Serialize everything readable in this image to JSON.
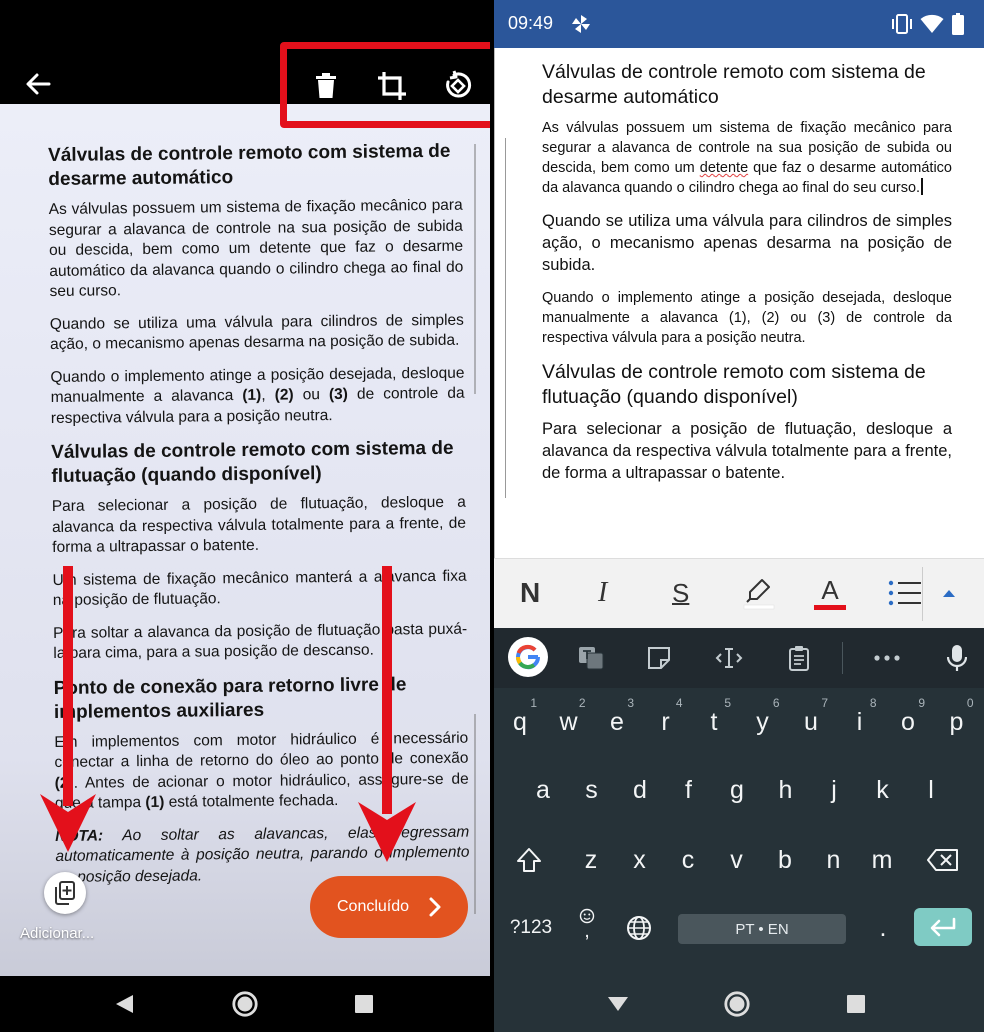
{
  "left_pane": {
    "toolbar": {
      "back_icon": "arrow-left-icon",
      "delete_icon": "trash-icon",
      "crop_icon": "crop-icon",
      "rotate_icon": "rotate-icon",
      "highlight_color": "#e3101b"
    },
    "scanned_document": {
      "heading_1": "Válvulas de controle remoto com sistema de desarme automático",
      "para_1": "As válvulas possuem um sistema de fixação mecânico para segurar a alavanca de controle na sua posição de subida ou descida, bem como um detente que faz o desarme automático da alavanca quando o cilindro chega ao final do seu curso.",
      "para_2": "Quando se utiliza uma válvula para cilindros de simples ação, o mecanismo apenas desarma na posição de subida.",
      "para_3_a": "Quando o implemento atinge a posição desejada, desloque manualmente a alavanca ",
      "para_3_b1": "(1)",
      "para_3_c": ", ",
      "para_3_b2": "(2)",
      "para_3_d": " ou ",
      "para_3_b3": "(3)",
      "para_3_e": " de controle da respectiva válvula para a posição neutra.",
      "heading_2": "Válvulas de controle remoto com sistema de flutuação (quando disponível)",
      "para_4": "Para selecionar a posição de flutuação, desloque a alavanca da respectiva válvula totalmente para a frente, de forma a ultrapassar o batente.",
      "para_5": "Um sistema de fixação mecânico manterá a alavanca fixa na posição de flutuação.",
      "para_6": "Para soltar a alavanca da posição de flutuação basta puxá-la para cima, para a sua posição de descanso.",
      "heading_3": "Ponto de conexão para retorno livre de implementos auxiliares",
      "para_7_a": "Em implementos com motor hidráulico é necessário conectar a linha de retorno do óleo ao ponto de conexão ",
      "para_7_b": "(2)",
      "para_7_c": ". Antes de acionar o motor hidráulico, assegure-se de que a tampa ",
      "para_7_d": "(1)",
      "para_7_e": " está totalmente fechada.",
      "nota_label": "NOTA:",
      "nota_text": " Ao soltar as alavancas, elas regressam automaticamente à posição neutra, parando o implemento na posição desejada."
    },
    "add_button_icon": "add-page-icon",
    "add_label": "Adicionar...",
    "done_button_label": "Concluído",
    "done_button_color": "#e2531f",
    "arrow_color": "#e3101b"
  },
  "right_pane": {
    "status_bar": {
      "time": "09:49",
      "bg_color": "#2b569a"
    },
    "document": {
      "heading_1": "Válvulas de controle remoto com sistema de desarme automático",
      "para_1_a": "As válvulas possuem um sistema de fixação mecânico para segurar a alavanca de controle na sua posição de subida ou descida, bem como um ",
      "para_1_spell": "detente",
      "para_1_b": " que faz o desarme automático da alavanca quando o cilindro chega ao final do seu curso.",
      "para_2": "Quando se utiliza uma válvula para cilindros de simples ação, o mecanismo apenas desarma na posição de subida.",
      "para_3": "Quando o implemento atinge a posição desejada, desloque manualmente a alavanca (1), (2) ou (3) de controle da respectiva válvula para a posição neutra.",
      "heading_2": "Válvulas de controle remoto com sistema de flutuação (quando disponível)",
      "para_4": "Para selecionar a posição de flutuação, desloque a alavanca da respectiva válvula totalmente para a frente, de forma a ultrapassar o batente."
    },
    "format_bar": {
      "bold": "N",
      "italic": "I",
      "strike": "S",
      "font_color": "A",
      "font_color_swatch": "#e3101b"
    },
    "keyboard": {
      "row1": [
        {
          "k": "q",
          "h": "1"
        },
        {
          "k": "w",
          "h": "2"
        },
        {
          "k": "e",
          "h": "3"
        },
        {
          "k": "r",
          "h": "4"
        },
        {
          "k": "t",
          "h": "5"
        },
        {
          "k": "y",
          "h": "6"
        },
        {
          "k": "u",
          "h": "7"
        },
        {
          "k": "i",
          "h": "8"
        },
        {
          "k": "o",
          "h": "9"
        },
        {
          "k": "p",
          "h": "0"
        }
      ],
      "row2": [
        "a",
        "s",
        "d",
        "f",
        "g",
        "h",
        "j",
        "k",
        "l"
      ],
      "row3": [
        "z",
        "x",
        "c",
        "v",
        "b",
        "n",
        "m"
      ],
      "symbols_key": "?123",
      "period_key": ".",
      "comma_key": ",",
      "space_label": "PT • EN",
      "enter_color": "#7fcbc4"
    }
  }
}
